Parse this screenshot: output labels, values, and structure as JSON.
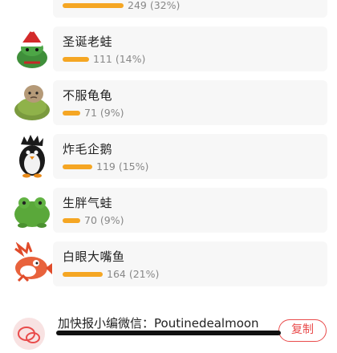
{
  "items": [
    {
      "name": "",
      "count": "249 (32%)",
      "percent": 32,
      "icon": "plush-pot-icon"
    },
    {
      "name": "圣诞老蛙",
      "count": "111 (14%)",
      "percent": 14,
      "icon": "santa-frog-plush-icon"
    },
    {
      "name": "不服龟龟",
      "count": "71 (9%)",
      "percent": 9,
      "icon": "turtle-plush-icon"
    },
    {
      "name": "炸毛企鹅",
      "count": "119 (15%)",
      "percent": 15,
      "icon": "penguin-plush-icon"
    },
    {
      "name": "生胖气蛙",
      "count": "70 (9%)",
      "percent": 9,
      "icon": "frog-plush-icon"
    },
    {
      "name": "白眼大嘴鱼",
      "count": "164 (21%)",
      "percent": 21,
      "icon": "fish-plush-icon"
    }
  ],
  "footer": {
    "text": "加快报小编微信：Poutinedealmoon",
    "copy_label": "复制"
  },
  "colors": {
    "bar": "#f5a623",
    "accent": "#e94b4b"
  }
}
